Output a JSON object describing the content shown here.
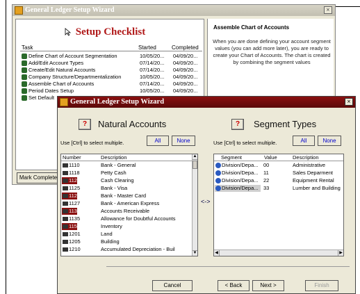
{
  "back_window": {
    "title": "General Ledger Setup Wizard",
    "close": "×",
    "checklist_title": "Setup Checklist",
    "columns": [
      "Task",
      "Started",
      "Completed"
    ],
    "tasks": [
      {
        "task": "Define Chart of Account Segmentation",
        "started": "10/05/20...",
        "completed": "04/09/20..."
      },
      {
        "task": "Add/Edit Account Types",
        "started": "07/14/20...",
        "completed": "04/09/20..."
      },
      {
        "task": "Create/Edit Natural Accounts",
        "started": "07/14/20...",
        "completed": "04/09/20..."
      },
      {
        "task": "Company Structure/Departmentalization",
        "started": "10/05/20...",
        "completed": "04/09/20..."
      },
      {
        "task": "Assemble Chart of Accounts",
        "started": "07/14/20...",
        "completed": "04/09/20..."
      },
      {
        "task": "Period Dates Setup",
        "started": "10/05/20...",
        "completed": "04/09/20..."
      },
      {
        "task": "Set Default",
        "started": "",
        "completed": ""
      }
    ],
    "info_title": "Assemble Chart of Accounts",
    "info_text": "When you are done defining your account segment values (you can add more later), you are ready to create your Chart of Accounts. The chart is created by combining the segment values",
    "mark_complete": "Mark Complete"
  },
  "front_window": {
    "title": "General Ledger Setup Wizard",
    "close": "×",
    "help_glyph": "?",
    "left": {
      "title": "Natural Accounts",
      "hint": "Use [Ctrl] to select multiple.",
      "all": "All",
      "none": "None",
      "columns": [
        "Number",
        "Description"
      ],
      "rows": [
        {
          "number": "1110",
          "desc": "Bank - General",
          "selected": false
        },
        {
          "number": "1118",
          "desc": "Petty Cash",
          "selected": false
        },
        {
          "number": "1120",
          "desc": "Cash Clearing",
          "selected": true
        },
        {
          "number": "1125",
          "desc": "Bank - Visa",
          "selected": false
        },
        {
          "number": "1126",
          "desc": "Bank - Master Card",
          "selected": true
        },
        {
          "number": "1127",
          "desc": "Bank - American Express",
          "selected": false
        },
        {
          "number": "1130",
          "desc": "Accounts Receivable",
          "selected": true
        },
        {
          "number": "1135",
          "desc": "Allowance for Doubtful Accounts",
          "selected": false
        },
        {
          "number": "1150",
          "desc": "Inventory",
          "selected": true
        },
        {
          "number": "1201",
          "desc": "Land",
          "selected": false
        },
        {
          "number": "1205",
          "desc": "Building",
          "selected": false
        },
        {
          "number": "1210",
          "desc": "Accumulated Depreciation - Buil",
          "selected": false
        }
      ]
    },
    "link_arrow": "<->",
    "right": {
      "title": "Segment Types",
      "hint": "Use [Ctrl] to select multiple.",
      "all": "All",
      "none": "None",
      "columns": [
        "Segment",
        "Value",
        "Description"
      ],
      "rows": [
        {
          "segment": "Division/Depa...",
          "value": "00",
          "desc": "Administrative",
          "selected": false
        },
        {
          "segment": "Division/Depa...",
          "value": "11",
          "desc": "Sales Deparment",
          "selected": false
        },
        {
          "segment": "Division/Depa...",
          "value": "22",
          "desc": "Equipment Rental",
          "selected": false
        },
        {
          "segment": "Division/Depa...",
          "value": "33",
          "desc": "Lumber and Building",
          "selected": true
        }
      ]
    },
    "buttons": {
      "cancel": "Cancel",
      "back": "< Back",
      "next": "Next >",
      "finish": "Finish"
    }
  },
  "colors": {
    "accent_red": "#b01818",
    "titlebar_active": "#8a1010",
    "dialog_bg": "#ece9d8"
  }
}
